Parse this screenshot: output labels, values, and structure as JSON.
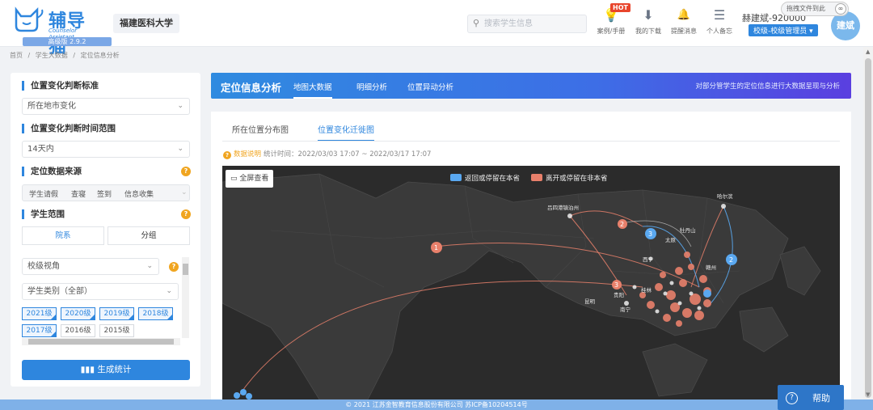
{
  "header": {
    "logo_name": "辅导猫",
    "logo_sub": "Counselor Assistant",
    "version": "高级版 2.9.2",
    "school": "福建医科大学",
    "search_placeholder": "搜索学生信息",
    "tools": [
      {
        "icon": "lightbulb-icon",
        "glyph": "💡",
        "label": "案例/手册",
        "badge": "HOT"
      },
      {
        "icon": "download-icon",
        "glyph": "⬇",
        "label": "我的下载"
      },
      {
        "icon": "bell-icon",
        "glyph": "🔔",
        "label": "提醒消息"
      },
      {
        "icon": "list-icon",
        "glyph": "☰",
        "label": "个人备忘"
      }
    ],
    "user": "赫建斌-920000",
    "role": "校级-校级管理员",
    "avatar": "建斌",
    "download_tooltip": "拖拽文件到此"
  },
  "breadcrumb": [
    "首页",
    "/",
    "学生大数据",
    "/",
    "定位信息分析"
  ],
  "left": {
    "s1_title": "位置变化判断标准",
    "s1_value": "所在地市变化",
    "s2_title": "位置变化判断时间范围",
    "s2_value": "14天内",
    "s3_title": "定位数据来源",
    "sources": [
      "学生请假",
      "查寝",
      "签到",
      "信息收集"
    ],
    "s4_title": "学生范围",
    "tab_institution": "院系",
    "tab_group": "分组",
    "view": "校级视角",
    "category": "学生类别（全部）",
    "years": [
      {
        "label": "2021级",
        "selected": true
      },
      {
        "label": "2020级",
        "selected": true
      },
      {
        "label": "2019级",
        "selected": true
      },
      {
        "label": "2018级",
        "selected": true
      },
      {
        "label": "2017级",
        "selected": true
      },
      {
        "label": "2016级",
        "selected": false
      },
      {
        "label": "2015级",
        "selected": false
      }
    ],
    "generate": "生成统计"
  },
  "topbar": {
    "title": "定位信息分析",
    "tabs": [
      "地图大数据",
      "明细分析",
      "位置异动分析"
    ],
    "desc": "对部分管学生的定位信息进行大数据呈现与分析"
  },
  "main": {
    "subtabs": [
      "所在位置分布图",
      "位置变化迁徙图"
    ],
    "note_label": "数据说明",
    "note_text": "统计时间：2022/03/03 17:07 ~ 2022/03/17 17:07",
    "fullscreen": "全屏查看",
    "legend_return": "返回或停留在本省",
    "legend_leave": "离开或停留在非本省",
    "color_return": "#5aa8f0",
    "color_leave": "#e8806b",
    "map_label_city1": "吕四港镇泊州",
    "map_label_city2": "哈尔滨",
    "map_label_city3": "牡丹山",
    "map_label_city4": "太原",
    "map_label_city5": "西宁",
    "map_label_city6": "昆明",
    "map_label_city7": "贵阳",
    "map_label_city8": "南宁",
    "map_label_city9": "桂林",
    "map_label_city10": "赣州",
    "badge1": "1",
    "badge2": "2",
    "badge3": "3"
  },
  "footer": {
    "copyright": "© 2021 江苏金智教育信息股份有限公司 苏ICP备10204514号",
    "help": "帮助"
  }
}
